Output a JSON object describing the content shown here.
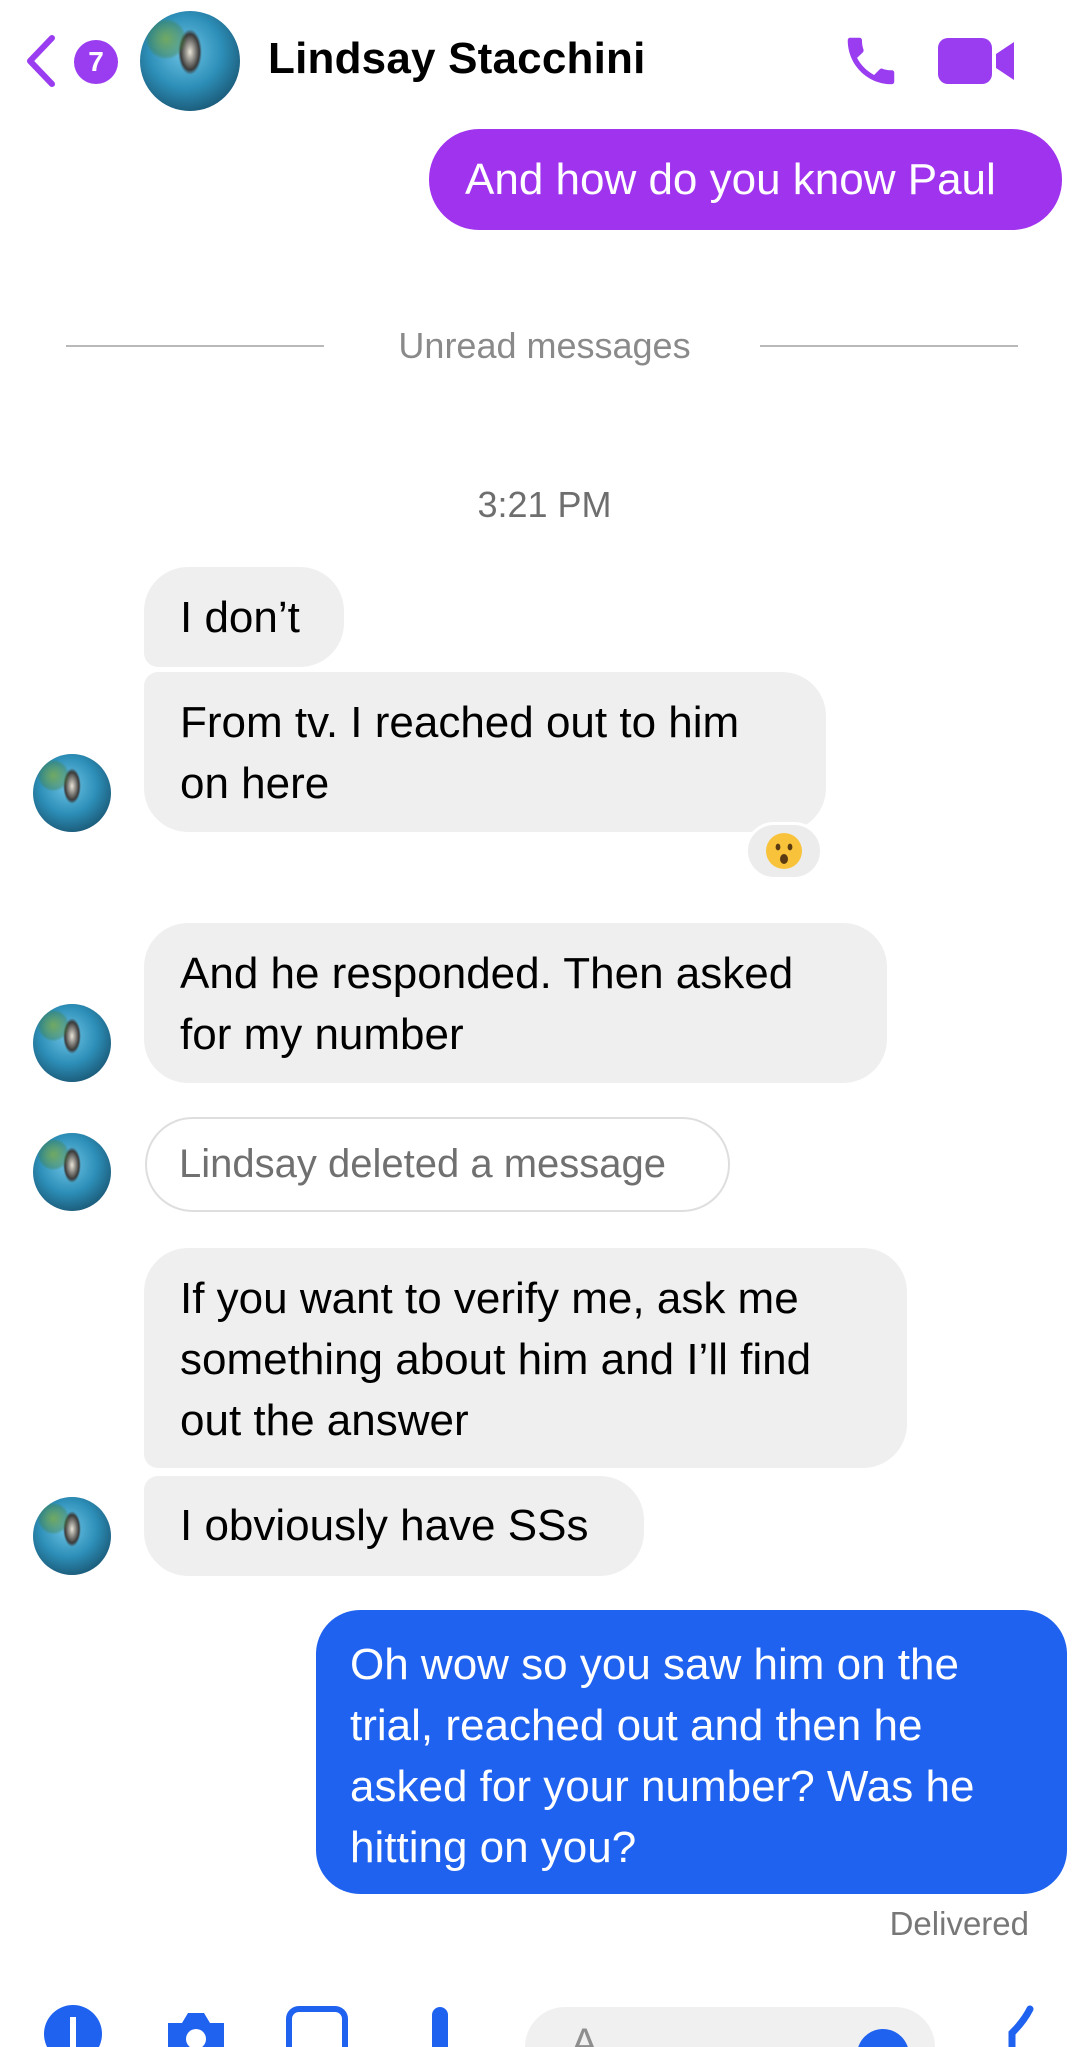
{
  "header": {
    "back_badge": "7",
    "contact_name": "Lindsay Stacchini"
  },
  "conversation": {
    "outgoing_top": "And how do you know Paul",
    "unread_divider": "Unread messages",
    "time": "3:21 PM",
    "incoming": [
      {
        "text": "I don’t"
      },
      {
        "text": "From tv. I reached out to him on here",
        "lines": [
          "From tv. I reached out to him",
          "on here"
        ],
        "reaction": "😮"
      },
      {
        "text": "And he responded. Then asked for my number",
        "lines": [
          "And he responded. Then asked",
          "for my number"
        ]
      },
      {
        "text": "Lindsay deleted a message",
        "deleted": true
      },
      {
        "text": "If you want to verify me, ask me something about him and I’ll find out the answer",
        "lines": [
          "If you want to verify me, ask me",
          "something about him and I’ll find",
          "out the answer"
        ]
      },
      {
        "text": "I obviously have SSs"
      }
    ],
    "outgoing_last": {
      "lines": [
        "Oh wow so you saw him on the",
        "trial, reached out and then he",
        "asked for your number? Was he",
        "hitting on you?"
      ]
    },
    "status": "Delivered"
  },
  "composer": {
    "placeholder": "A"
  },
  "colors": {
    "accent_purple": "#a034ee",
    "outgoing_blue": "#1f62f0",
    "incoming_gray": "#efefef"
  },
  "icons": [
    "back-chevron-icon",
    "phone-icon",
    "video-camera-icon",
    "plus-icon",
    "camera-icon",
    "image-icon",
    "microphone-icon",
    "emoji-icon",
    "like-icon"
  ]
}
